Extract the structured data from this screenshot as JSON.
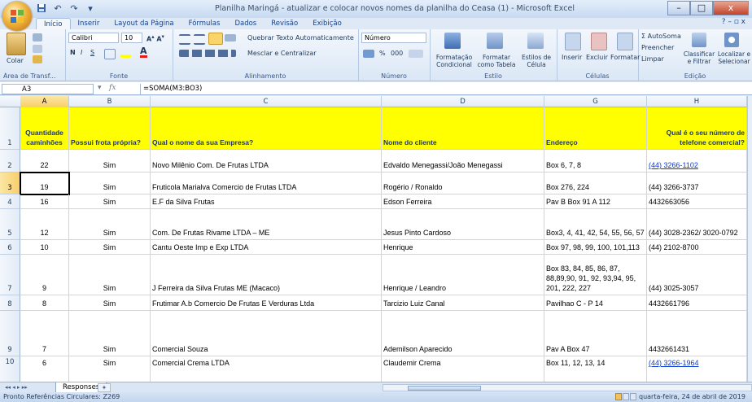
{
  "window": {
    "title": "Planilha Maringá - atualizar e colocar novos nomes da planilha do Ceasa (1) - Microsoft Excel",
    "min": "–",
    "max": "□",
    "close": "x"
  },
  "qat": [
    "↶",
    "↷",
    "▾"
  ],
  "tabs": [
    "Início",
    "Inserir",
    "Layout da Página",
    "Fórmulas",
    "Dados",
    "Revisão",
    "Exibição"
  ],
  "help": "? – ▫ x",
  "ribbon": {
    "clipboard": {
      "label": "Área de Transf...",
      "paste": "Colar"
    },
    "font": {
      "label": "Fonte",
      "name": "Calibri",
      "size": "10",
      "bold": "N",
      "italic": "I",
      "underline": "S"
    },
    "alignment": {
      "label": "Alinhamento",
      "wrap": "Quebrar Texto Automaticamente",
      "merge": "Mesclar e Centralizar"
    },
    "number": {
      "label": "Número",
      "format": "Número",
      "percent": "%",
      "thousands": "000"
    },
    "style": {
      "label": "Estilo",
      "conditional": "Formatação Condicional",
      "table": "Formatar como Tabela",
      "cell": "Estilos de Célula"
    },
    "cells": {
      "label": "Células",
      "insert": "Inserir",
      "delete": "Excluir",
      "format": "Formatar"
    },
    "editing": {
      "label": "Edição",
      "autosum": "Σ AutoSoma",
      "fill": "Preencher",
      "clear": "Limpar",
      "sort": "Classificar e Filtrar",
      "find": "Localizar e Selecionar"
    }
  },
  "formula_bar": {
    "name_box": "A3",
    "fx": "fx",
    "formula": "=SOMA(M3:BO3)"
  },
  "columns": [
    "A",
    "B",
    "C",
    "D",
    "G",
    "H"
  ],
  "header_row": {
    "num": "1",
    "cells": [
      "Quantidade caminhões",
      "Possui frota própria?",
      "Qual o nome da sua Empresa?",
      "Nome do cliente",
      "Endereço",
      "Qual é o seu número de telefone comercial?"
    ]
  },
  "rows": [
    {
      "num": "2",
      "cells": [
        "22",
        "Sim",
        "Novo Milênio Com. De Frutas LTDA",
        "Edvaldo Menegassi/João Menegassi",
        "Box 6, 7, 8",
        "(44) 3266-1102"
      ]
    },
    {
      "num": "3",
      "cells": [
        "19",
        "Sim",
        "Fruticola Marialva Comercio de Frutas LTDA",
        "Rogério / Ronaldo",
        "Box 276, 224",
        "(44) 3266-3737"
      ]
    },
    {
      "num": "4",
      "cells": [
        "16",
        "Sim",
        "E.F da Silva Frutas",
        "Edson Ferreira",
        "Pav B Box 91 A 112",
        "4432663056"
      ]
    },
    {
      "num": "5",
      "cells": [
        "12",
        "Sim",
        "Com. De Frutas Rivame LTDA – ME",
        "Jesus Pinto Cardoso",
        "Box3, 4, 41, 42, 54, 55, 56, 57",
        "(44) 3028-2362/ 3020-0792"
      ]
    },
    {
      "num": "6",
      "cells": [
        "10",
        "Sim",
        "Cantu Oeste Imp e Exp LTDA",
        "Henrique",
        "Box 97, 98, 99, 100, 101,113",
        "(44) 2102-8700"
      ]
    },
    {
      "num": "7",
      "cells": [
        "9",
        "Sim",
        "J Ferreira da Silva Frutas ME (Macaco)",
        "Henrique / Leandro",
        "Box 83, 84, 85, 86, 87, 88,89,90, 91, 92, 93,94, 95, 201, 222, 227",
        "(44) 3025-3057"
      ]
    },
    {
      "num": "8",
      "cells": [
        "8",
        "Sim",
        "Frutimar A.b Comercio De Frutas E Verduras Ltda",
        "Tarcizio Luiz Canal",
        "Pavilhao C - P 14",
        "4432661796"
      ]
    },
    {
      "num": "9",
      "cells": [
        "7",
        "Sim",
        "Comercial Souza",
        "Ademilson Aparecido",
        "Pav A Box 47",
        "4432661431"
      ]
    },
    {
      "num": "10",
      "cells": [
        "6",
        "Sim",
        "Comercial Crema LTDA",
        "Claudemir Crema",
        "Box 11, 12, 13, 14",
        "(44) 3266-1964"
      ]
    }
  ],
  "sheet": {
    "name": "Responses",
    "nav": "◂◂ ◂ ▸ ▸▸"
  },
  "status": {
    "left": "Pronto   Referências Circulares: Z269",
    "date": "quarta-feira, 24 de abril de 2019"
  }
}
